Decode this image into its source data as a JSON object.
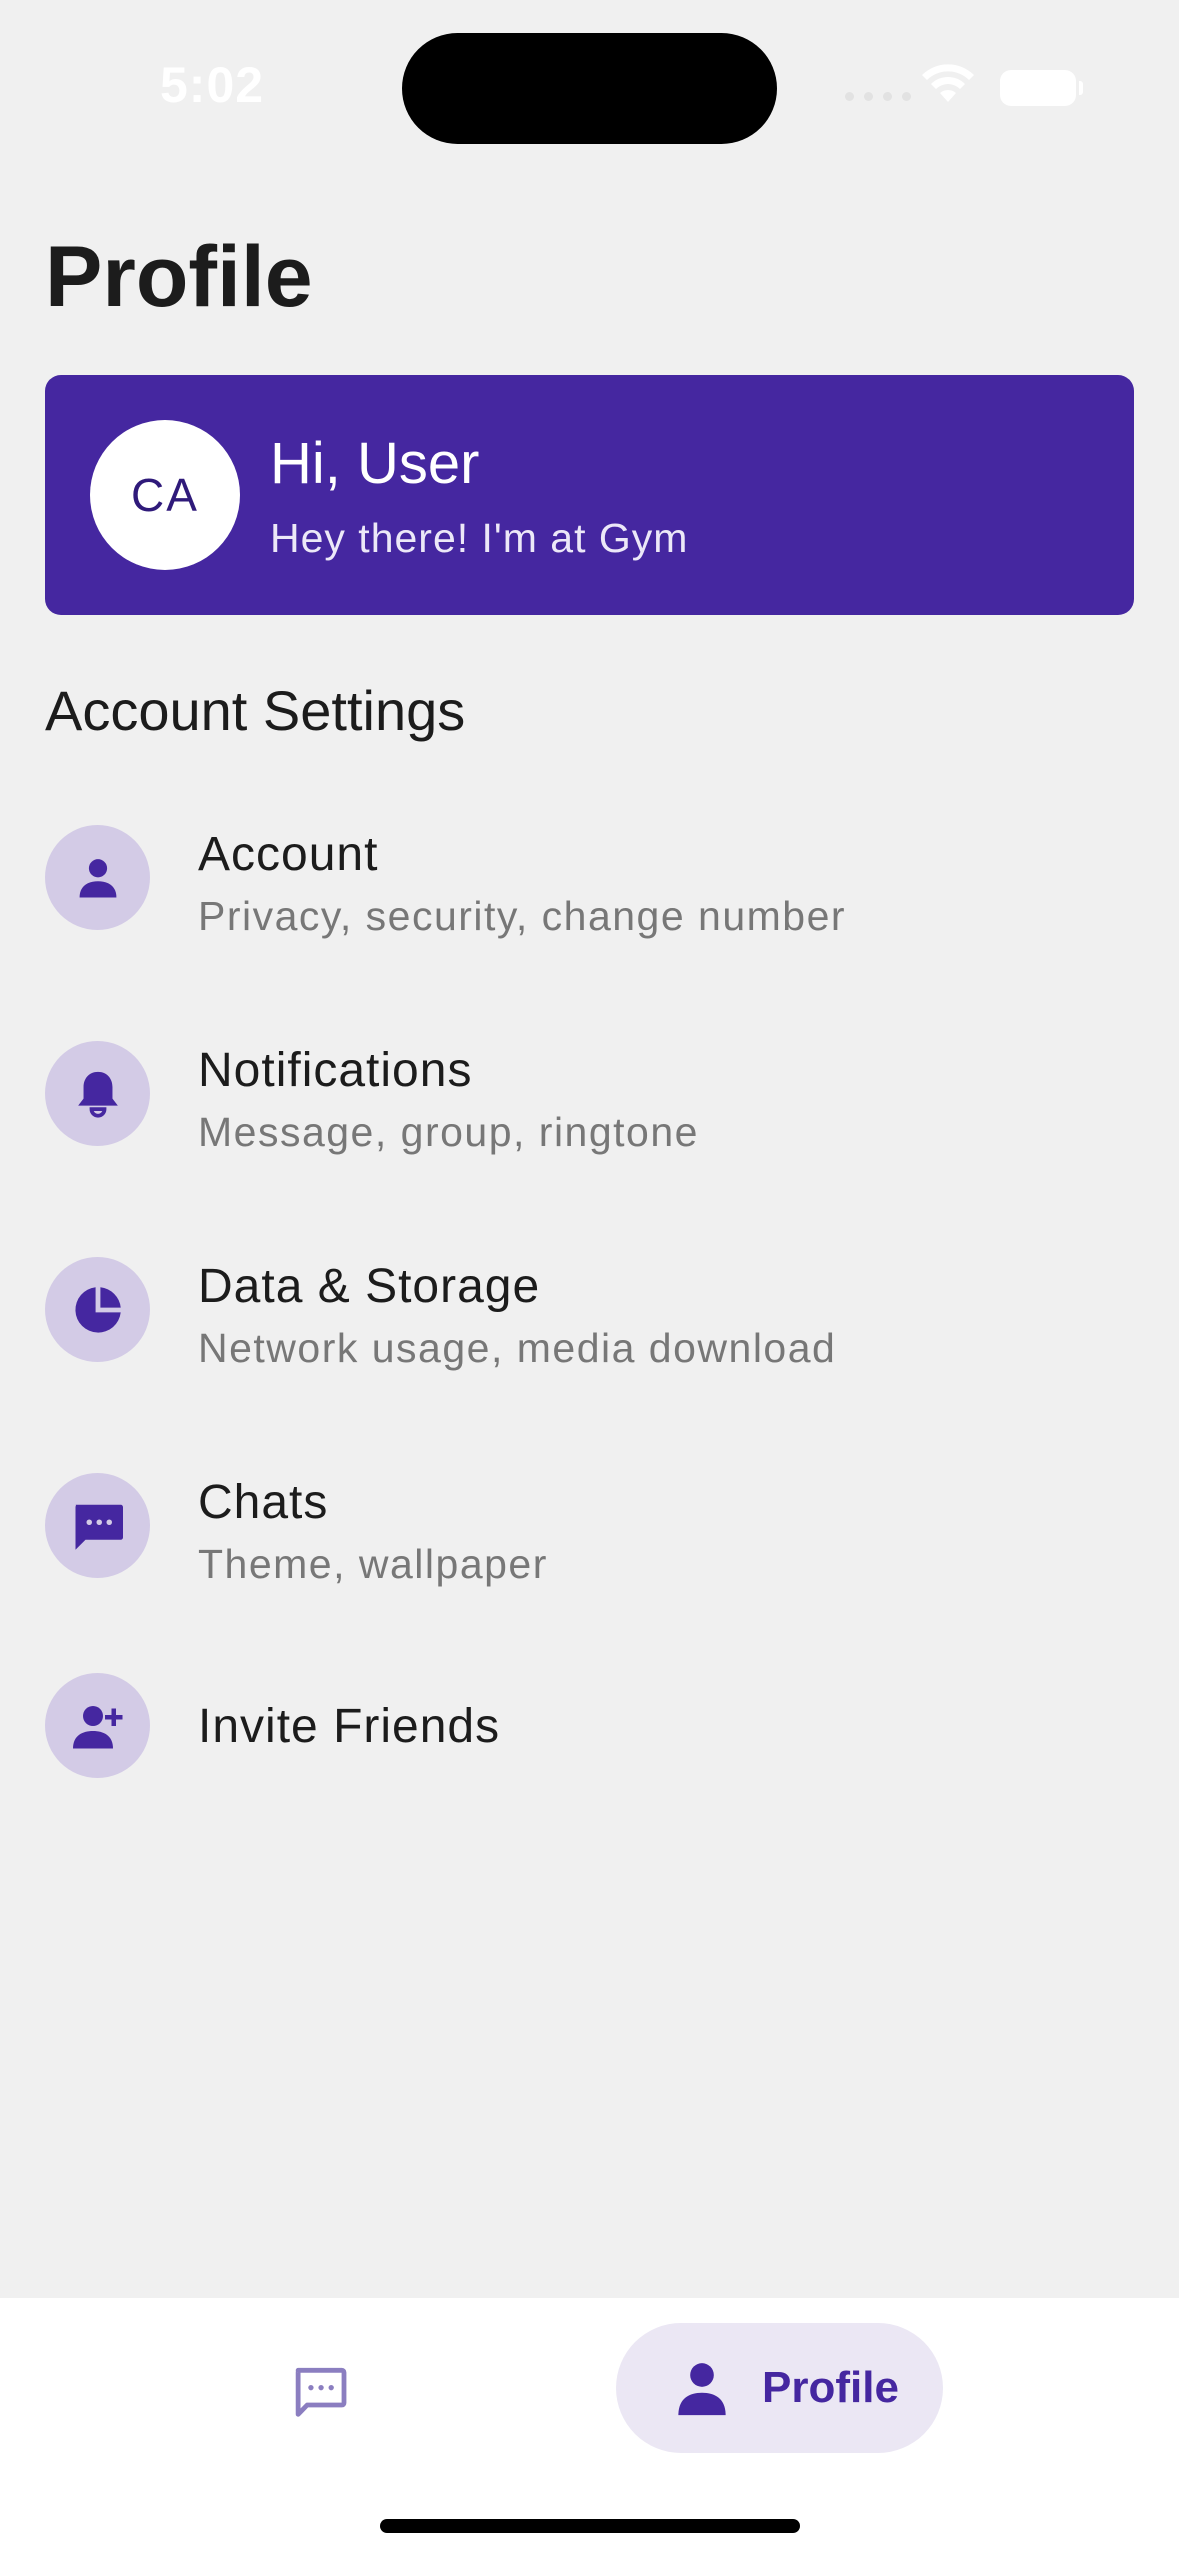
{
  "status_bar": {
    "time": "5:02"
  },
  "page": {
    "title": "Profile"
  },
  "profile_card": {
    "avatar_initials": "CA",
    "greeting": "Hi, User",
    "status": "Hey there! I'm at Gym"
  },
  "section": {
    "title": "Account Settings"
  },
  "settings": [
    {
      "title": "Account",
      "subtitle": "Privacy, security, change number",
      "icon": "person-icon"
    },
    {
      "title": "Notifications",
      "subtitle": "Message, group, ringtone",
      "icon": "bell-icon"
    },
    {
      "title": "Data & Storage",
      "subtitle": "Network usage, media download",
      "icon": "pie-chart-icon"
    },
    {
      "title": "Chats",
      "subtitle": "Theme, wallpaper",
      "icon": "chat-bubble-icon"
    },
    {
      "title": "Invite Friends",
      "icon": "person-add-icon"
    }
  ],
  "bottom_nav": {
    "chats_icon": "chat-bubble-outline-icon",
    "profile_label": "Profile",
    "profile_icon": "person-icon"
  },
  "colors": {
    "accent": "#4527a0",
    "icon_bg": "#d3cbe6",
    "background": "#f0f0f0"
  }
}
